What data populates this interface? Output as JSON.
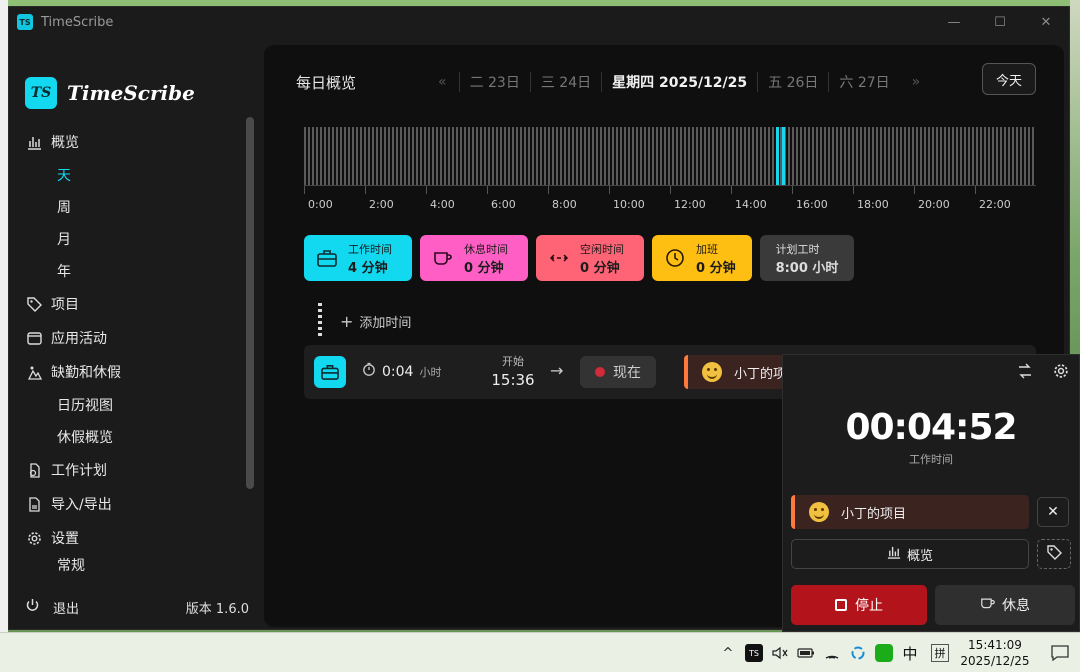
{
  "window": {
    "title": "TimeScribe",
    "icon_text": "TS",
    "controls": [
      "—",
      "☐",
      "✕"
    ]
  },
  "sidebar": {
    "logo_badge": "TS",
    "logo_text": "TimeScribe",
    "items": [
      {
        "label": "概览",
        "icon": "chart-icon"
      },
      {
        "label": "天",
        "sub": true,
        "active": true
      },
      {
        "label": "周",
        "sub": true
      },
      {
        "label": "月",
        "sub": true
      },
      {
        "label": "年",
        "sub": true
      },
      {
        "label": "项目",
        "icon": "tag-icon"
      },
      {
        "label": "应用活动",
        "icon": "window-icon"
      },
      {
        "label": "缺勤和休假",
        "icon": "vacation-icon"
      },
      {
        "label": "日历视图",
        "sub": true
      },
      {
        "label": "休假概览",
        "sub": true
      },
      {
        "label": "工作计划",
        "icon": "plan-icon"
      },
      {
        "label": "导入/导出",
        "icon": "file-icon"
      },
      {
        "label": "设置",
        "icon": "gear-icon"
      },
      {
        "label": "常规",
        "sub": true
      }
    ],
    "footer_label": "退出",
    "version": "版本 1.6.0"
  },
  "header": {
    "title": "每日概览",
    "prev_arrow": "«",
    "next_arrow": "»",
    "days": [
      "二 23日",
      "三 24日",
      "星期四 2025/12/25",
      "五 26日",
      "六 27日"
    ],
    "current_index": 2,
    "today_button": "今天"
  },
  "timeline": {
    "labels": [
      "0:00",
      "2:00",
      "4:00",
      "6:00",
      "8:00",
      "10:00",
      "12:00",
      "14:00",
      "16:00",
      "18:00",
      "20:00",
      "22:00"
    ],
    "active_fractions": [
      0.645,
      0.653
    ],
    "accent": "#16d6f0"
  },
  "stats": [
    {
      "key": "work",
      "label": "工作时间",
      "value": "4 分钟",
      "icon": "briefcase-icon",
      "color": "#12d8f0"
    },
    {
      "key": "break",
      "label": "休息时间",
      "value": "0 分钟",
      "icon": "coffee-icon",
      "color": "#ff5fc4"
    },
    {
      "key": "idle",
      "label": "空闲时间",
      "value": "0 分钟",
      "icon": "idle-icon",
      "color": "#ff6376"
    },
    {
      "key": "overtime",
      "label": "加班",
      "value": "0 分钟",
      "icon": "clock-up-icon",
      "color": "#ffbf12"
    },
    {
      "key": "plan",
      "label": "计划工时",
      "value": "8:00 小时",
      "color": "#3a3a3a"
    }
  ],
  "add_time": "添加时间",
  "entry": {
    "duration": "0:04",
    "duration_unit": "小时",
    "start_label": "开始",
    "start_time": "15:36",
    "now_label": "现在",
    "project": "小丁的项目"
  },
  "widget": {
    "timer": "00:04:52",
    "timer_label": "工作时间",
    "project": "小丁的项目",
    "close": "✕",
    "overview": "概览",
    "stop": "停止",
    "break": "休息"
  },
  "taskbar": {
    "tray_ts": "TS",
    "ime_lang": "中",
    "ime_mode": "拼",
    "time": "15:41:09",
    "date": "2025/12/25"
  }
}
